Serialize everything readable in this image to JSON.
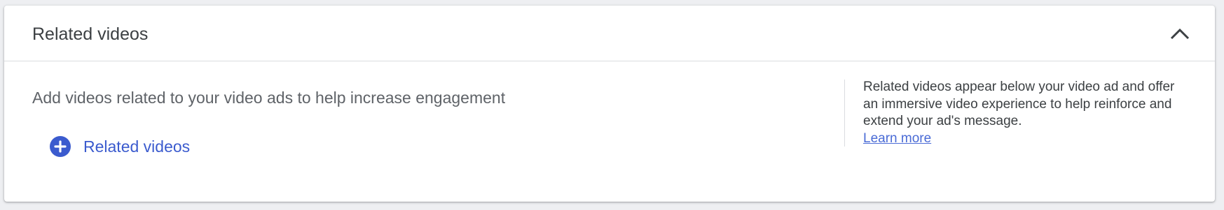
{
  "card": {
    "title": "Related videos",
    "collapse_icon": "chevron-up-icon"
  },
  "body": {
    "description": "Add videos related to your video ads to help increase engagement",
    "add_button": {
      "icon": "add-circle-icon",
      "label": "Related videos"
    }
  },
  "help": {
    "text": "Related videos appear below your video ad and offer an immersive video experience to help reinforce and extend your ad's message.",
    "link_label": "Learn more"
  },
  "colors": {
    "accent": "#3b5bce",
    "link": "#4a6bd6",
    "title_text": "#3c4043",
    "secondary_text": "#5f6368",
    "divider": "#dadce0",
    "page_background": "#eeeff2"
  }
}
